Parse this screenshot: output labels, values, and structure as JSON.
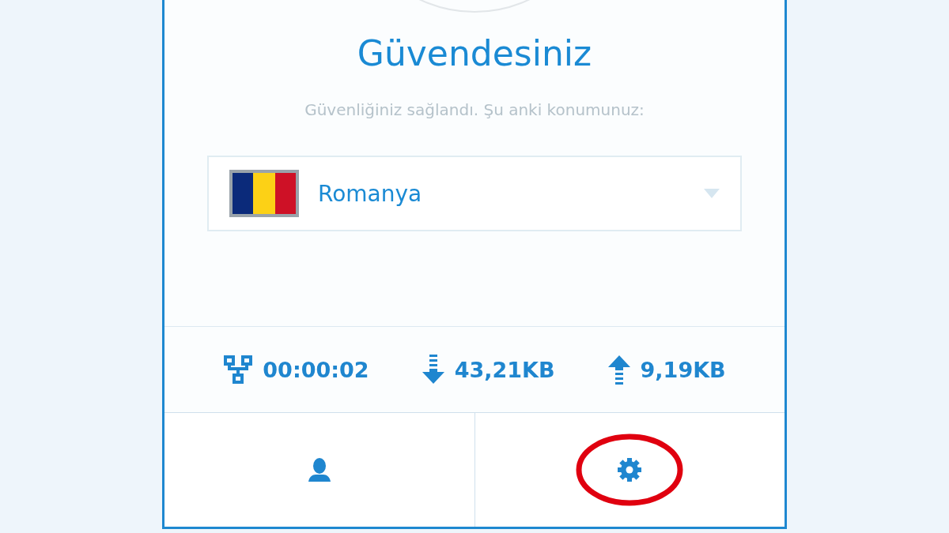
{
  "status": {
    "title": "Güvendesiniz",
    "message": "Güvenliğiniz sağlandı. Şu anki konumunuz:"
  },
  "location": {
    "country": "Romanya"
  },
  "stats": [
    {
      "kind": "duration",
      "value": "00:00:02"
    },
    {
      "kind": "download",
      "value": "43,21KB"
    },
    {
      "kind": "upload",
      "value": "9,19KB"
    }
  ],
  "nav": [
    {
      "kind": "account",
      "highlighted": false
    },
    {
      "kind": "settings",
      "highlighted": true
    }
  ]
}
